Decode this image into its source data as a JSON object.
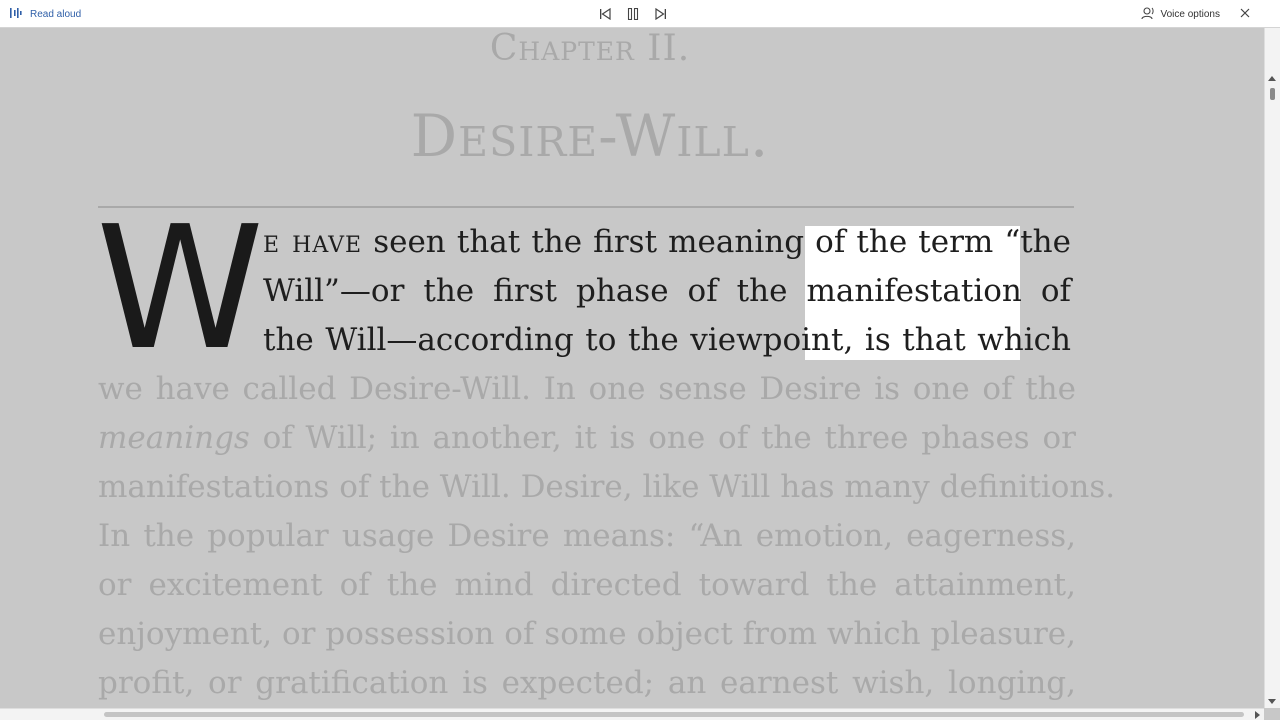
{
  "toolbar": {
    "read_aloud_label": "Read aloud",
    "voice_options_label": "Voice options",
    "icons": {
      "read_aloud": "read-aloud-icon",
      "previous": "skip-previous-icon",
      "pause": "pause-icon",
      "next": "skip-next-icon",
      "voice": "voice-options-icon",
      "close": "close-icon"
    },
    "accent_color": "#2f5fa8"
  },
  "page": {
    "chapter_heading": "Chapter II.",
    "title": "Desire-Will.",
    "drop_cap": "W",
    "paragraph_lines": [
      {
        "lead": "e have",
        "text": " seen that the first meaning of the term “the",
        "style": "dark"
      },
      {
        "lead": "",
        "text": "Will”—or the first phase of the manifestation of",
        "style": "dark"
      },
      {
        "lead": "",
        "text": "the Will—according to the viewpoint, is that which",
        "style": "dark"
      },
      {
        "lead": "",
        "text": "we have called Desire-Will. In one sense Desire is one of the",
        "style": "light"
      },
      {
        "lead": "",
        "italic": "meanings",
        "text": " of Will; in another, it is one of the three phases or",
        "style": "light"
      },
      {
        "lead": "",
        "text": "manifestations of the Will. Desire, like Will has many definitions.",
        "style": "light"
      },
      {
        "lead": "",
        "text": "In the popular usage Desire means: “An emotion, eagerness,",
        "style": "light"
      },
      {
        "lead": "",
        "text": "or excitement of the mind directed toward the attainment,",
        "style": "light"
      },
      {
        "lead": "",
        "text": "enjoyment, or possession of some object from which pleasure,",
        "style": "light"
      },
      {
        "lead": "",
        "text": "profit, or gratification is expected; an earnest wish, longing,",
        "style": "light"
      }
    ],
    "text_color_active": "#1e1e1e",
    "text_color_dimmed": "#a9a9a9",
    "highlight_color": "#ffffff"
  }
}
